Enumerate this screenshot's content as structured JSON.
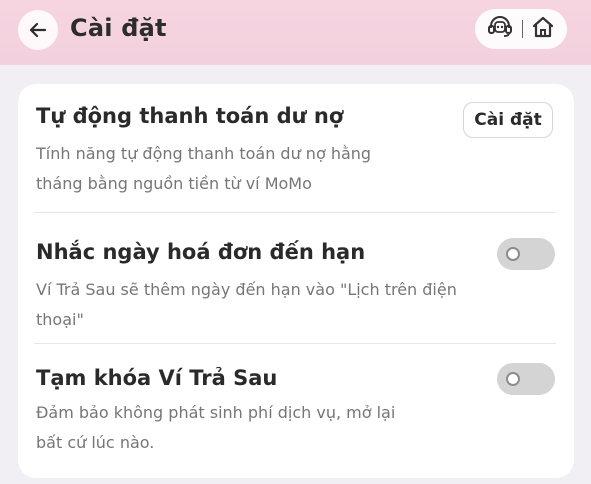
{
  "header": {
    "title": "Cài đặt",
    "back_icon": "arrow-left-icon",
    "support_icon": "headset-icon",
    "home_icon": "home-icon"
  },
  "settings": [
    {
      "title": "Tự động thanh toán dư nợ",
      "description_lines": [
        "Tính năng tự động thanh toán dư nợ hằng",
        "tháng bằng nguồn tiền từ ví MoMo"
      ],
      "action_label": "Cài đặt"
    },
    {
      "title": "Nhắc ngày hoá đơn đến hạn",
      "description_lines": [
        "Ví Trả Sau sẽ thêm ngày đến hạn vào \"Lịch trên điện",
        "thoại\""
      ],
      "toggle_on": false
    },
    {
      "title": "Tạm khóa Ví Trả Sau",
      "description_lines": [
        "Đảm bảo không phát sinh phí dịch vụ, mở lại",
        "bất cứ lúc nào."
      ],
      "toggle_on": false
    }
  ],
  "colors": {
    "header_bg": "#f6d5e1",
    "page_bg": "#f1eff4",
    "toggle_off": "#d4d4d4"
  }
}
